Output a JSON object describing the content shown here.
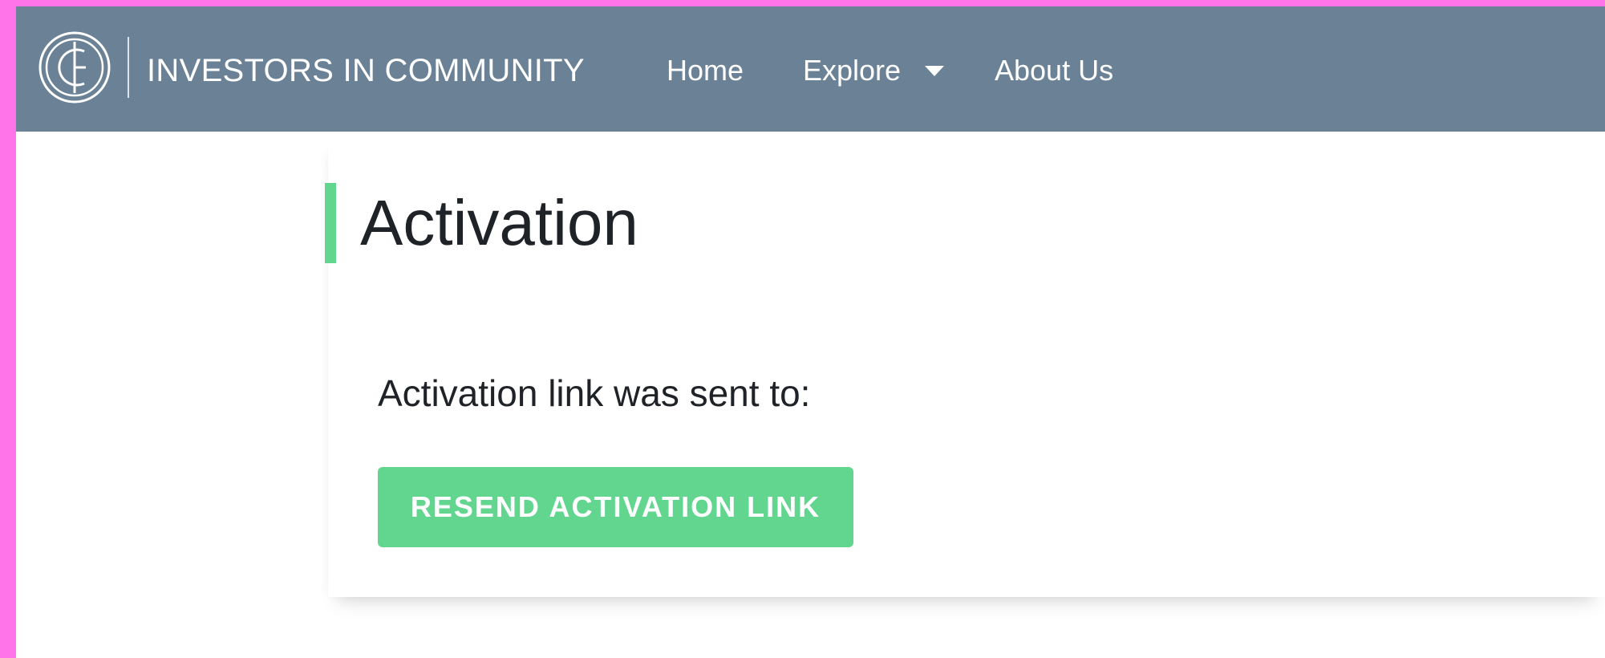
{
  "colors": {
    "frame": "#ff74e8",
    "navbar": "#6b8296",
    "accent": "#62d68f",
    "text": "#1f2328",
    "nav_text": "#ffffff"
  },
  "brand": {
    "name": "INVESTORS IN COMMUNITY",
    "logo_icon": "circular-ic-monogram-icon"
  },
  "nav": {
    "items": [
      {
        "label": "Home"
      },
      {
        "label": "Explore",
        "icon": "caret-down-icon"
      },
      {
        "label": "About Us"
      }
    ]
  },
  "page": {
    "title": "Activation",
    "message": "Activation link was sent to:",
    "resend_label": "RESEND ACTIVATION LINK"
  }
}
